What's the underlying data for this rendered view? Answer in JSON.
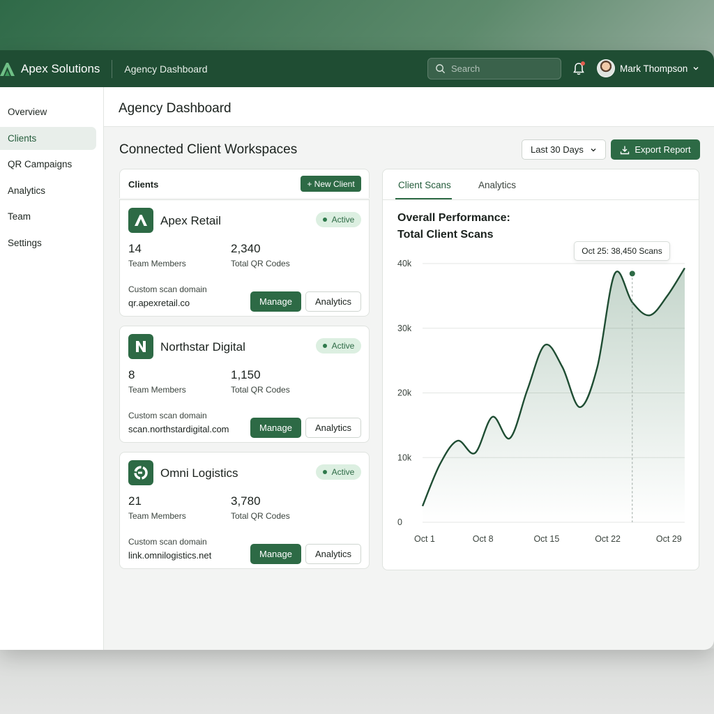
{
  "app": {
    "brand": "Apex Solutions",
    "section": "Agency Dashboard"
  },
  "search": {
    "placeholder": "Search"
  },
  "user": {
    "name": "Mark Thompson"
  },
  "sidebar": {
    "items": [
      {
        "label": "Overview",
        "active": false
      },
      {
        "label": "Clients",
        "active": true
      },
      {
        "label": "QR Campaigns",
        "active": false
      },
      {
        "label": "Analytics",
        "active": false
      },
      {
        "label": "Team",
        "active": false
      },
      {
        "label": "Settings",
        "active": false
      }
    ]
  },
  "page": {
    "title": "Agency Dashboard",
    "section_title": "Connected Client Workspaces"
  },
  "toolbar": {
    "range": "Last 30 Days",
    "export": "Export Report"
  },
  "clients": {
    "header": "Clients",
    "new_client": "+ New Client",
    "domain_label": "Custom scan domain",
    "members_label": "Team Members",
    "codes_label": "Total QR Codes",
    "manage_label": "Manage",
    "analytics_label": "Analytics",
    "items": [
      {
        "name": "Apex Retail",
        "status": "Active",
        "members": "14",
        "codes": "2,340",
        "domain": "qr.apexretail.co"
      },
      {
        "name": "Northstar Digital",
        "status": "Active",
        "members": "8",
        "codes": "1,150",
        "domain": "scan.northstardigital.com"
      },
      {
        "name": "Omni Logistics",
        "status": "Active",
        "members": "21",
        "codes": "3,780",
        "domain": "link.omnilogistics.net"
      }
    ]
  },
  "chart_panel": {
    "tabs": [
      "Client Scans",
      "Analytics"
    ],
    "title_line1": "Overall Performance:",
    "title_line2": "Total Client Scans",
    "tooltip": "Oct 25: 38,450 Scans"
  },
  "colors": {
    "brand": "#1f4d33",
    "accent": "#2d6a45",
    "active_badge": "#dcefe1"
  },
  "chart_data": {
    "type": "area",
    "x": [
      "Oct 1",
      "Oct 3",
      "Oct 5",
      "Oct 7",
      "Oct 9",
      "Oct 11",
      "Oct 13",
      "Oct 15",
      "Oct 17",
      "Oct 19",
      "Oct 21",
      "Oct 23",
      "Oct 25",
      "Oct 27",
      "Oct 29",
      "Oct 31"
    ],
    "values": [
      2500,
      9000,
      12600,
      10700,
      16300,
      13000,
      20500,
      27400,
      24000,
      17800,
      24000,
      38450,
      34000,
      32000,
      35000,
      39300
    ],
    "x_ticks": [
      "Oct 1",
      "Oct 8",
      "Oct 15",
      "Oct 22",
      "Oct 29"
    ],
    "y_ticks": [
      "0",
      "10k",
      "20k",
      "30k",
      "40k"
    ],
    "ylim": [
      0,
      40000
    ],
    "highlight": {
      "x": "Oct 25",
      "value": 38450
    },
    "grid": true
  }
}
